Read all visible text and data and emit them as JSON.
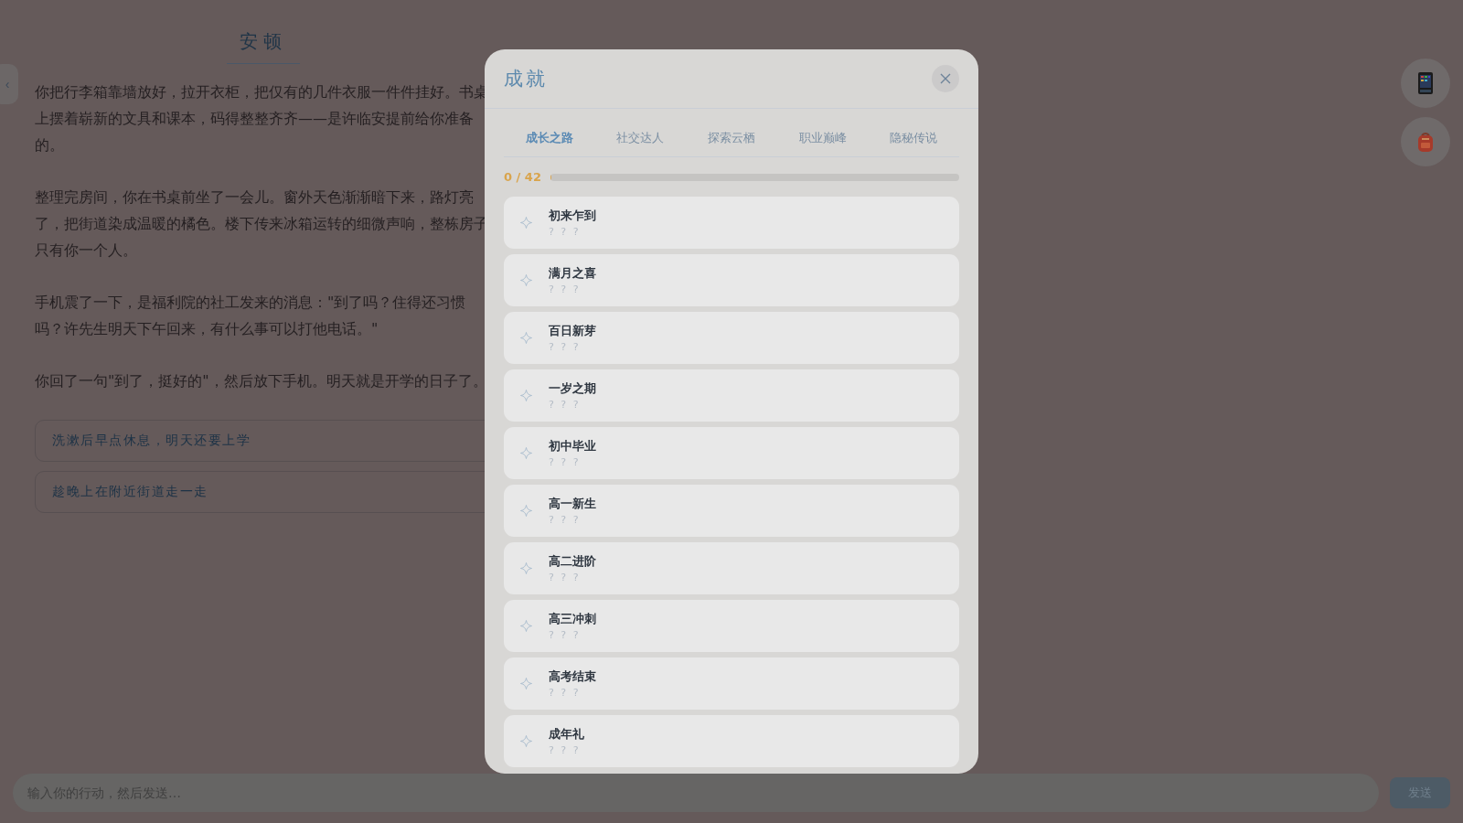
{
  "story": {
    "title": "安顿",
    "paragraphs": [
      "你把行李箱靠墙放好，拉开衣柜，把仅有的几件衣服一件件挂好。书桌上摆着崭新的文具和课本，码得整整齐齐——是许临安提前给你准备的。",
      "整理完房间，你在书桌前坐了一会儿。窗外天色渐渐暗下来，路灯亮了，把街道染成温暖的橘色。楼下传来冰箱运转的细微声响，整栋房子只有你一个人。",
      "手机震了一下，是福利院的社工发来的消息：\"到了吗？住得还习惯吗？许先生明天下午回来，有什么事可以打他电话。\"",
      "你回了一句\"到了，挺好的\"，然后放下手机。明天就是开学的日子了。"
    ],
    "choices": [
      "洗漱后早点休息，明天还要上学",
      "趁晚上在附近街道走一走"
    ]
  },
  "sidebar_toggle": "‹",
  "input": {
    "placeholder": "输入你的行动，然后发送…"
  },
  "send_button": "发送",
  "modal": {
    "title": "成就",
    "tabs": [
      {
        "label": "成长之路",
        "selected": true
      },
      {
        "label": "社交达人",
        "selected": false
      },
      {
        "label": "探索云栖",
        "selected": false
      },
      {
        "label": "职业巅峰",
        "selected": false
      },
      {
        "label": "隐秘传说",
        "selected": false
      }
    ],
    "progress": {
      "text": "0 / 42",
      "level": 0
    },
    "achievements": [
      {
        "name": "初来乍到",
        "description": "? ? ?",
        "locked": true
      },
      {
        "name": "满月之喜",
        "description": "? ? ?",
        "locked": true
      },
      {
        "name": "百日新芽",
        "description": "? ? ?",
        "locked": true
      },
      {
        "name": "一岁之期",
        "description": "? ? ?",
        "locked": true
      },
      {
        "name": "初中毕业",
        "description": "? ? ?",
        "locked": true
      },
      {
        "name": "高一新生",
        "description": "? ? ?",
        "locked": true
      },
      {
        "name": "高二进阶",
        "description": "? ? ?",
        "locked": true
      },
      {
        "name": "高三冲刺",
        "description": "? ? ?",
        "locked": true
      },
      {
        "name": "高考结束",
        "description": "? ? ?",
        "locked": true
      },
      {
        "name": "成年礼",
        "description": "? ? ?",
        "locked": true
      }
    ]
  }
}
